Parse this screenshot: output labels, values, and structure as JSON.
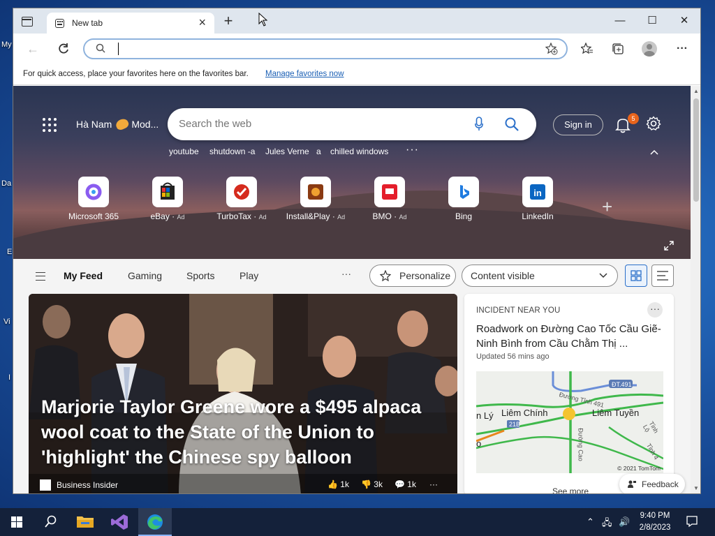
{
  "desktop": {
    "labels": [
      "My",
      "Da",
      "E",
      "Vi",
      "I"
    ]
  },
  "browser": {
    "tab": {
      "title": "New tab"
    },
    "window_controls": {
      "minimize": "—",
      "maximize": "☐",
      "close": "✕"
    },
    "favbar": {
      "text": "For quick access, place your favorites here on the favorites bar.",
      "link": "Manage favorites now"
    }
  },
  "newtab": {
    "location": "Hà Nam",
    "weather": "Mod...",
    "search_placeholder": "Search the web",
    "sign_in": "Sign in",
    "notifications_count": "5",
    "recent_searches": [
      "youtube",
      "shutdown -a",
      "Jules Verne",
      "a",
      "chilled windows"
    ],
    "more": "···",
    "quick_links": [
      {
        "label": "Microsoft 365",
        "ad": ""
      },
      {
        "label": "eBay",
        "ad": "Ad"
      },
      {
        "label": "TurboTax",
        "ad": "Ad"
      },
      {
        "label": "Install&Play",
        "ad": "Ad"
      },
      {
        "label": "BMO",
        "ad": "Ad"
      },
      {
        "label": "Bing",
        "ad": ""
      },
      {
        "label": "LinkedIn",
        "ad": ""
      }
    ],
    "add_link": "+"
  },
  "feednav": {
    "items": [
      "My Feed",
      "Gaming",
      "Sports",
      "Play"
    ],
    "more": "···",
    "personalize": "Personalize",
    "content_select": "Content visible"
  },
  "main_card": {
    "headline": "Marjorie Taylor Greene wore a $495 alpaca wool coat to the State of the Union to 'highlight' the Chinese spy balloon",
    "source": "Business Insider",
    "likes": "1k",
    "dislikes": "3k",
    "comments": "1k",
    "more": "···"
  },
  "side_card": {
    "kicker": "INCIDENT NEAR YOU",
    "more": "···",
    "title": "Roadwork on Đường Cao Tốc Cầu Giẽ-Ninh Bình from Cầu Chằm Thị ...",
    "updated": "Updated 56 mins ago",
    "map": {
      "labels": [
        "Liêm Chính",
        "Liêm Tuyền",
        "n Lý",
        "o",
        "Đường Tỉnh 491",
        "ĐT.491",
        "21B",
        "Đường Cao",
        "Tỉnh Lộ",
        "Tỉnh 4"
      ],
      "credit": "© 2021 TomTom"
    },
    "see_more": "See more"
  },
  "feedback": "Feedback",
  "taskbar": {
    "time": "9:40 PM",
    "date": "2/8/2023"
  },
  "colors": {
    "accent": "#1a5fb4",
    "badge": "#e8641c",
    "taskbar": "#14213a"
  }
}
